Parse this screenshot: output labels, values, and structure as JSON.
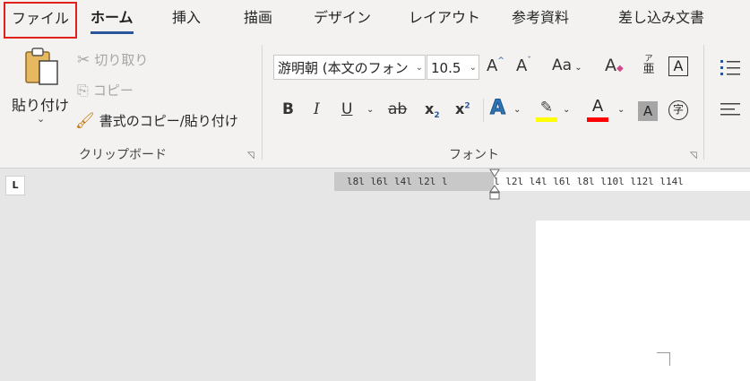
{
  "tabs": [
    {
      "label": "ファイル"
    },
    {
      "label": "ホーム"
    },
    {
      "label": "挿入"
    },
    {
      "label": "描画"
    },
    {
      "label": "デザイン"
    },
    {
      "label": "レイアウト"
    },
    {
      "label": "参考資料"
    },
    {
      "label": "差し込み文書"
    }
  ],
  "clipboard": {
    "paste_label": "貼り付け",
    "cut_label": "切り取り",
    "copy_label": "コピー",
    "format_painter_label": "書式のコピー/貼り付け",
    "group_label": "クリップボード"
  },
  "font": {
    "font_name": "游明朝 (本文のフォン",
    "font_size": "10.5",
    "case_label": "Aa",
    "group_label": "フォント",
    "bold": "B",
    "italic": "I",
    "underline": "U",
    "strike": "ab",
    "subscript": "x",
    "sub2": "2",
    "superscript": "x",
    "sup2": "2",
    "phonetic": "亜",
    "phonetic_small": "ア",
    "grow": "A",
    "shrink": "A",
    "clear": "A",
    "char_border": "A",
    "text_effects": "A",
    "font_color": "A",
    "char_shading": "A",
    "enclose": "字"
  },
  "ruler": {
    "left_text": "l8l l6l l4l l2l l",
    "right_text": "l l2l l4l l6l l8l l10l l12l l14l",
    "tab_selector": "L"
  },
  "colors": {
    "accent": "#2b579a",
    "highlight": "#ffff00",
    "font_color": "#ff0000",
    "file_outline": "#e0201b"
  }
}
